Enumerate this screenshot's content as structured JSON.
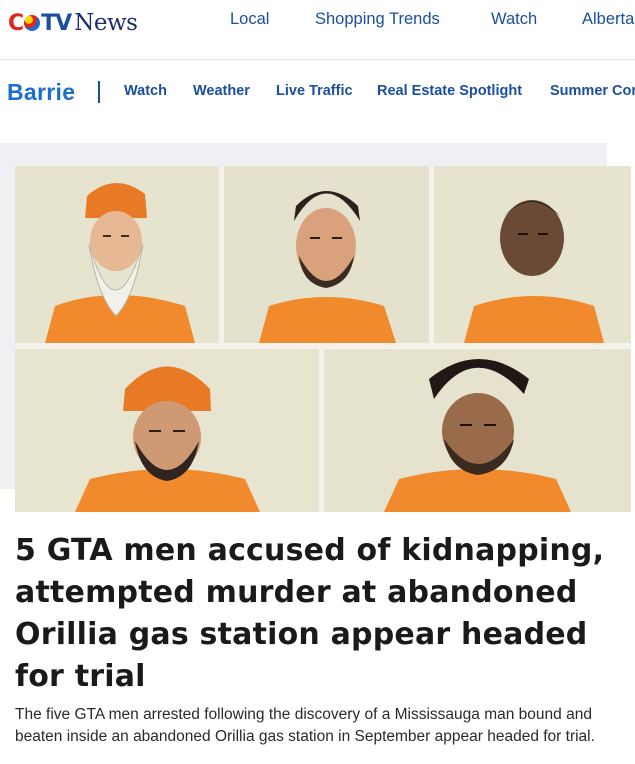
{
  "brand": {
    "logo_ctv": "CTV",
    "logo_news": "News"
  },
  "top_nav": [
    "Local",
    "Shopping Trends",
    "Watch",
    "Alberta"
  ],
  "section": {
    "title": "Barrie",
    "links": [
      "Watch",
      "Weather",
      "Live Traffic",
      "Real Estate Spotlight",
      "Summer Cor"
    ]
  },
  "article": {
    "headline": "5 GTA men accused of kidnapping, attempted murder at abandoned Orillia gas station appear headed for trial",
    "summary": "The five GTA men arrested following the discovery of a Mississauga man bound and beaten inside an abandoned Orillia gas station in September appear headed for trial."
  },
  "colors": {
    "brand_blue": "#1b4fa0",
    "section_blue": "#1b6ed1",
    "jumpsuit_orange": "#f08a2c"
  },
  "icons": [
    "ctv-logo"
  ]
}
